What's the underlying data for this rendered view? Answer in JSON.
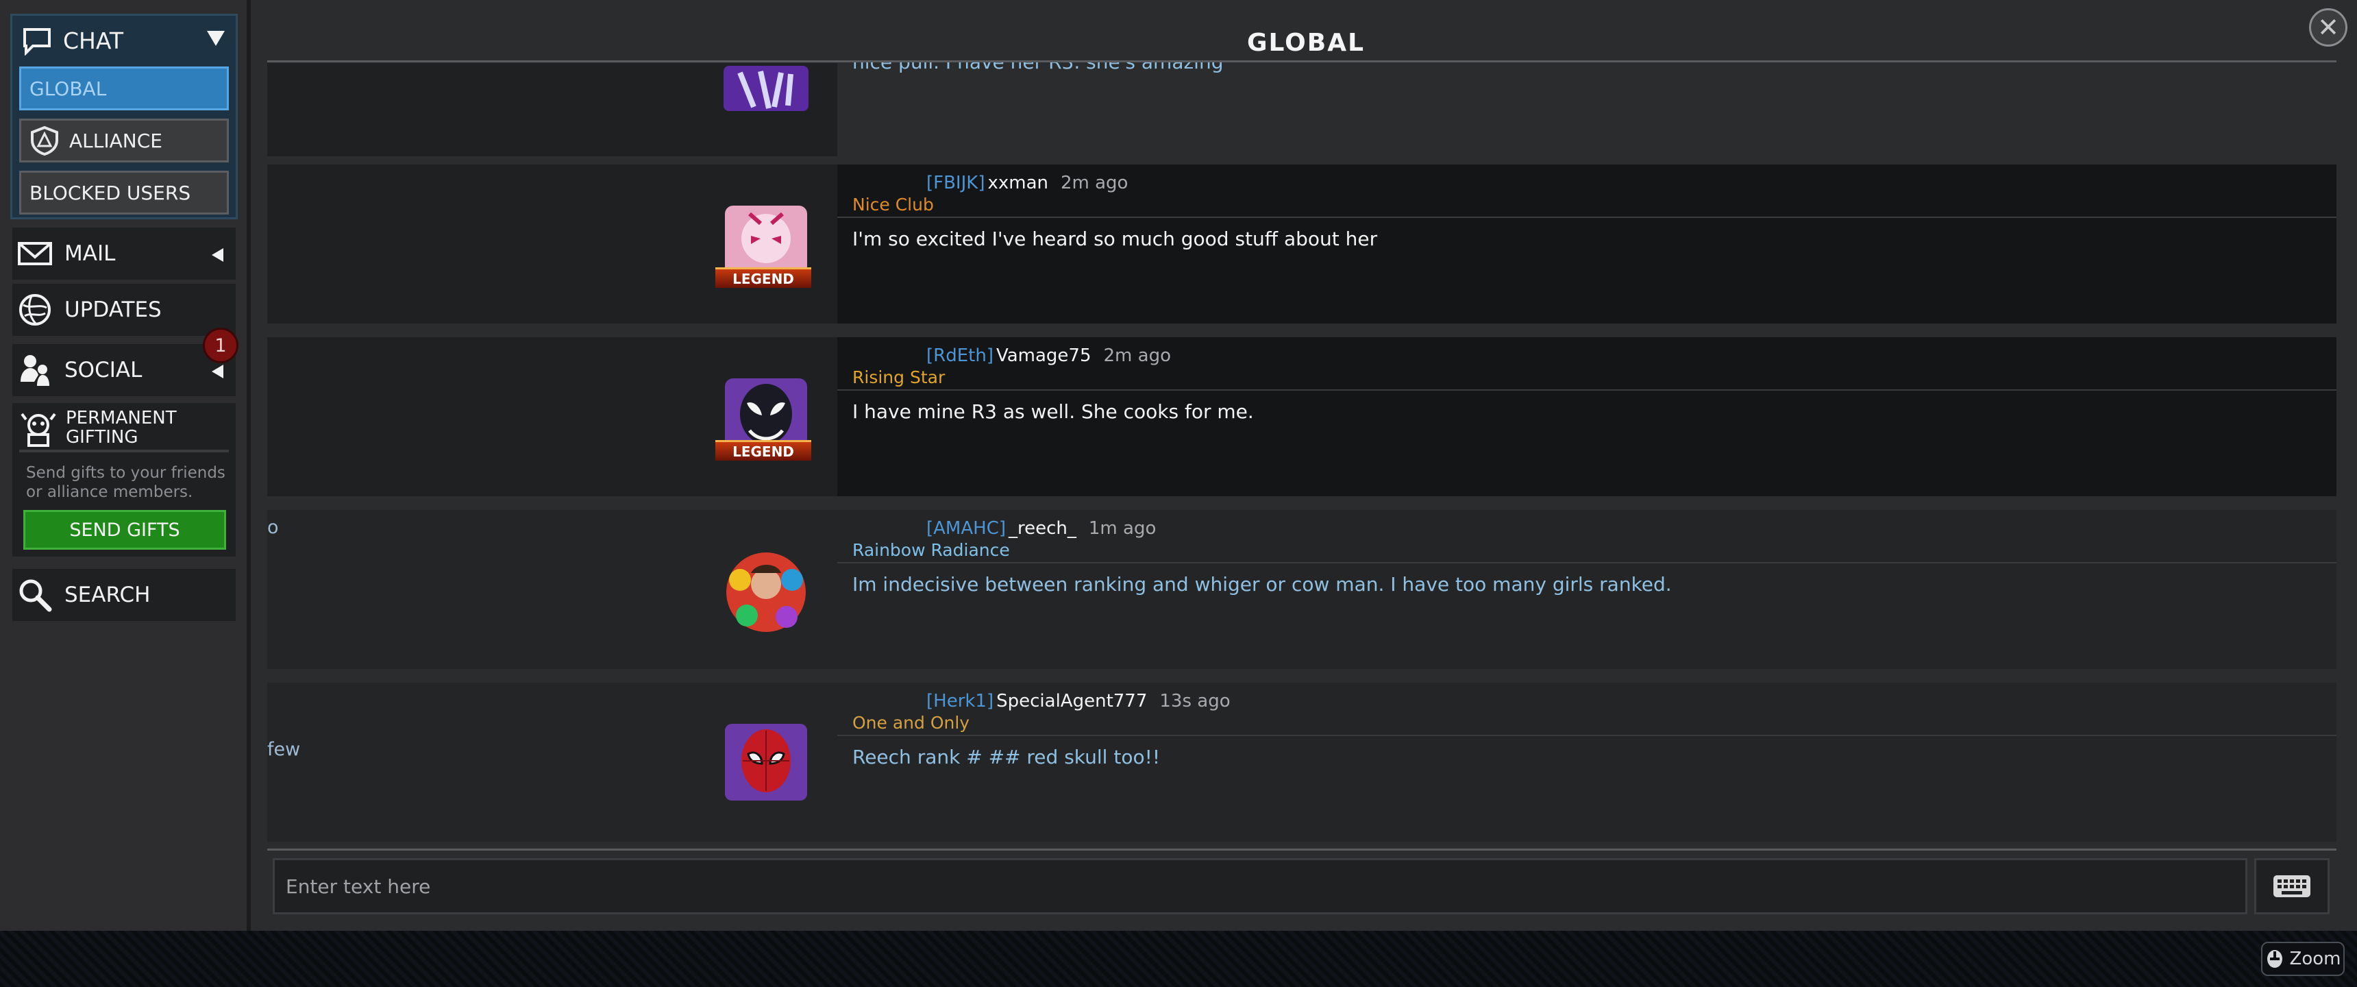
{
  "sidebar": {
    "chat": {
      "label": "CHAT"
    },
    "global": {
      "label": "GLOBAL"
    },
    "alliance": {
      "label": "ALLIANCE"
    },
    "blocked": {
      "label": "BLOCKED USERS"
    },
    "mail": {
      "label": "MAIL"
    },
    "updates": {
      "label": "UPDATES"
    },
    "social": {
      "label": "SOCIAL",
      "badge": "1"
    },
    "gifting": {
      "title_line1": "PERMANENT",
      "title_line2": "GIFTING",
      "description": "Send gifts to your friends or alliance members.",
      "button": "SEND GIFTS"
    },
    "search": {
      "label": "SEARCH"
    }
  },
  "main": {
    "title": "GLOBAL",
    "close": "✕",
    "partial_message": "nice pull. I have her R3. she's amazing",
    "messages": [
      {
        "alliance_tag": "[FBIJK]",
        "username": "xxman",
        "time": "2m ago",
        "title": "Nice Club",
        "title_color": "#e08b2a",
        "text": "I'm so excited I've heard so much good stuff about her",
        "text_color": "#f3f3f3",
        "badge": "LEGEND",
        "avatar": "gwenpool-avatar"
      },
      {
        "alliance_tag": "[RdEth]",
        "username": "Vamage75",
        "time": "2m ago",
        "title": "Rising Star",
        "title_color": "#e0a52a",
        "text": "I have mine R3 as well.  She cooks for me.",
        "text_color": "#f3f3f3",
        "badge": "LEGEND",
        "avatar": "venom-avatar"
      },
      {
        "alliance_tag": "[AMAHC]",
        "username": "_reech_",
        "time": "1m ago",
        "title": "Rainbow Radiance",
        "title_color": "#7fc0e8",
        "text": "Im indecisive between ranking and whiger or cow man.  I have too many girls ranked.",
        "text_color": "#8fc0e2",
        "left_stub": "o",
        "avatar": "hero-rainbow-avatar"
      },
      {
        "alliance_tag": "[Herk1]",
        "username": "SpecialAgent777",
        "time": "13s ago",
        "title": "One and Only",
        "title_color": "#d4a040",
        "text": "Reech rank # ## red skull too!!",
        "text_color": "#8fc0e2",
        "left_stub": "few",
        "avatar": "spiderman-avatar"
      }
    ],
    "input": {
      "placeholder": "Enter text here"
    }
  },
  "bottom": {
    "zoom": "Zoom"
  }
}
